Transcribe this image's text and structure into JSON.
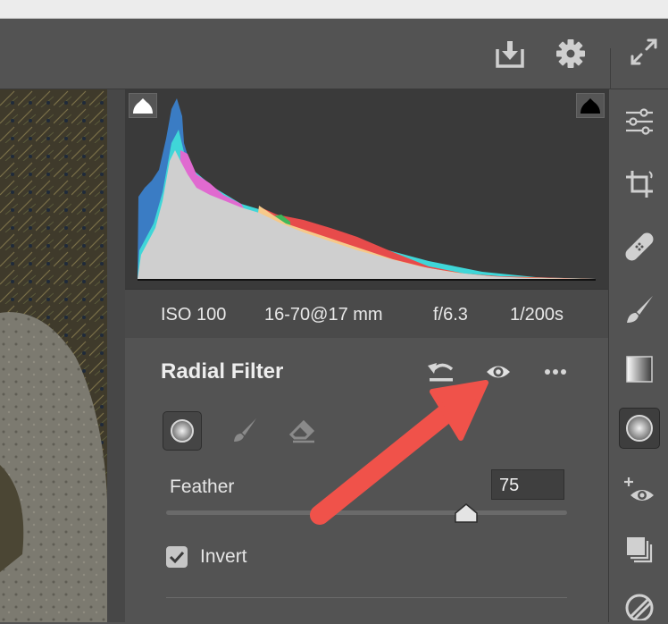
{
  "toolbar": {
    "icons": [
      "save-download-icon",
      "gear-icon",
      "fullscreen-icon"
    ]
  },
  "histogram": {
    "shadow_clipping_warning": "white-triangle",
    "highlight_clipping_warning": "black-triangle"
  },
  "exif": {
    "iso": "ISO 100",
    "lens": "16-70@17 mm",
    "aperture": "f/6.3",
    "shutter": "1/200s"
  },
  "panel": {
    "title": "Radial Filter",
    "feather": {
      "label": "Feather",
      "value": "75",
      "slider_level": 0.75
    },
    "invert": {
      "label": "Invert",
      "checked": true
    }
  },
  "rail": {
    "tools": [
      "edit-sliders-icon",
      "crop-icon",
      "healing-bandage-icon",
      "brush-icon",
      "graduated-filter-icon",
      "radial-filter-icon",
      "red-eye-icon",
      "presets-icon",
      "snapshots-icon"
    ],
    "active": "radial-filter-icon"
  },
  "colors": {
    "panel_bg": "#535353",
    "histogram_bg": "#3a3a3a",
    "annotation_arrow": "#f0524a"
  }
}
